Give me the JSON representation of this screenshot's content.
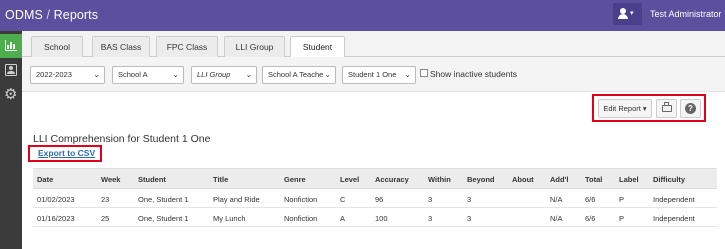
{
  "header": {
    "app_name": "ODMS",
    "separator": "/",
    "section": "Reports",
    "user_name": "Test Administrator",
    "user_caret": "▾"
  },
  "sidebar": {
    "items": [
      {
        "icon": "bar-chart-icon",
        "active": true
      },
      {
        "icon": "contact-card-icon",
        "active": false
      },
      {
        "icon": "gear-icon",
        "glyph": "⚙",
        "active": false
      }
    ]
  },
  "tabs": [
    {
      "label": "School",
      "active": false
    },
    {
      "label": "BAS Class",
      "active": false
    },
    {
      "label": "FPC Class",
      "active": false
    },
    {
      "label": "LLI Group",
      "active": false
    },
    {
      "label": "Student",
      "active": true
    }
  ],
  "filters": {
    "year": "2022-2023",
    "school": "School A",
    "group": "LLI Group",
    "teacher": "School A Teache",
    "student": "Student 1 One",
    "chevron": "⌄",
    "inactive_label": "Show inactive students",
    "inactive_checked": false
  },
  "toolbar": {
    "edit_report": "Edit Report ▾",
    "help_glyph": "?"
  },
  "report": {
    "title": "LLI Comprehension for Student 1 One",
    "export_label": "Export to CSV"
  },
  "table": {
    "columns": [
      "Date",
      "Week",
      "Student",
      "Title",
      "Genre",
      "Level",
      "Accuracy",
      "Within",
      "Beyond",
      "About",
      "Add'l",
      "Total",
      "Label",
      "Difficulty"
    ],
    "rows": [
      [
        "01/02/2023",
        "23",
        "One, Student 1",
        "Play and Ride",
        "Nonfiction",
        "C",
        "96",
        "3",
        "3",
        "",
        "N/A",
        "6/6",
        "P",
        "Independent"
      ],
      [
        "01/16/2023",
        "25",
        "One, Student 1",
        "My Lunch",
        "Nonfiction",
        "A",
        "100",
        "3",
        "3",
        "",
        "N/A",
        "6/6",
        "P",
        "Independent"
      ]
    ]
  },
  "colors": {
    "topbar": "#5b4f9e",
    "sidebar": "#3b3b3b",
    "active_sidebar": "#4cae4c",
    "highlight_box": "#e0001b",
    "link": "#2a6db6"
  }
}
